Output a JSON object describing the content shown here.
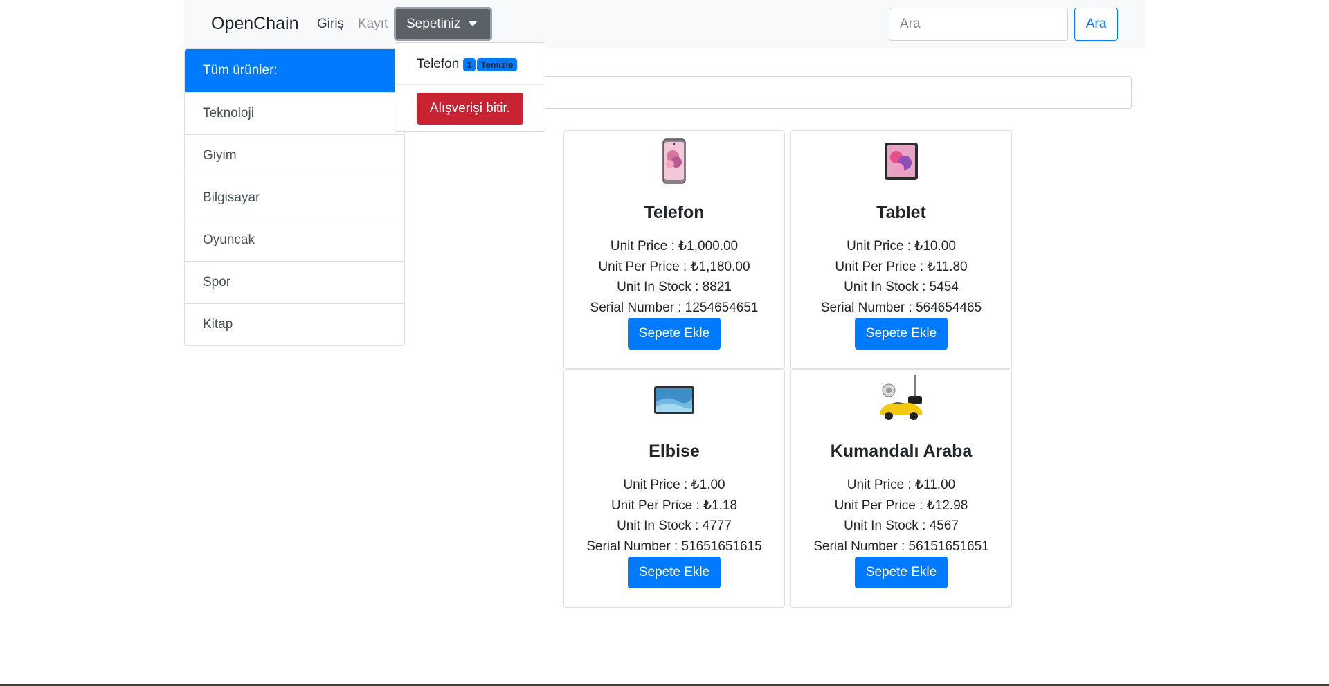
{
  "navbar": {
    "brand": "OpenChain",
    "login": "Giriş",
    "register": "Kayıt",
    "cart_toggle": "Sepetiniz",
    "search_placeholder": "Ara",
    "search_button": "Ara"
  },
  "cart_dropdown": {
    "item_name": "Telefon",
    "item_count": "1",
    "clear_label": "Temizle",
    "checkout_label": "Alışverişi bitir."
  },
  "sidebar": {
    "items": [
      {
        "label": "Tüm ürünler:",
        "active": true
      },
      {
        "label": "Teknoloji"
      },
      {
        "label": "Giyim"
      },
      {
        "label": "Bilgisayar"
      },
      {
        "label": "Oyuncak"
      },
      {
        "label": "Spor"
      },
      {
        "label": "Kitap"
      }
    ]
  },
  "products": [
    {
      "name": "Telefon",
      "image_icon": "smartphone-icon",
      "unit_price": "Unit Price : ₺1,000.00",
      "unit_per_price": "Unit Per Price : ₺1,180.00",
      "unit_in_stock": "Unit In Stock : 8821",
      "serial_number": "Serial Number : 1254654651",
      "button": "Sepete Ekle"
    },
    {
      "name": "Tablet",
      "image_icon": "tablet-icon",
      "unit_price": "Unit Price : ₺10.00",
      "unit_per_price": "Unit Per Price : ₺11.80",
      "unit_in_stock": "Unit In Stock : 5454",
      "serial_number": "Serial Number : 564654465",
      "button": "Sepete Ekle"
    },
    {
      "name": "Elbise",
      "image_icon": "tablet-landscape-icon",
      "unit_price": "Unit Price : ₺1.00",
      "unit_per_price": "Unit Per Price : ₺1.18",
      "unit_in_stock": "Unit In Stock : 4777",
      "serial_number": "Serial Number : 51651651615",
      "button": "Sepete Ekle"
    },
    {
      "name": "Kumandalı Araba",
      "image_icon": "rc-car-icon",
      "unit_price": "Unit Price : ₺11.00",
      "unit_per_price": "Unit Per Price : ₺12.98",
      "unit_in_stock": "Unit In Stock : 4567",
      "serial_number": "Serial Number : 56151651651",
      "button": "Sepete Ekle"
    }
  ],
  "colors": {
    "primary": "#007bff",
    "danger": "#c82333",
    "secondary": "#5a6268",
    "navbar_bg": "#f8f9fa"
  }
}
